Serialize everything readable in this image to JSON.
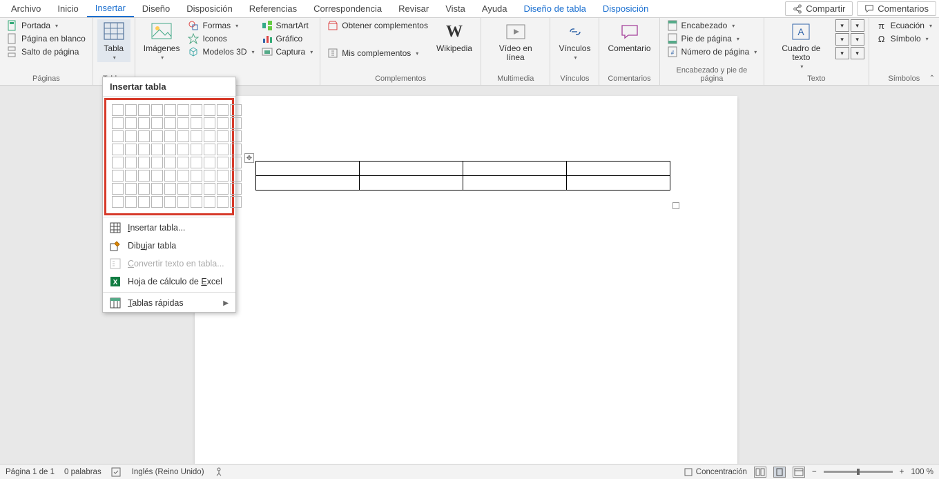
{
  "tabs": {
    "file": "Archivo",
    "home": "Inicio",
    "insert": "Insertar",
    "design": "Diseño",
    "layout": "Disposición",
    "references": "Referencias",
    "mail": "Correspondencia",
    "review": "Revisar",
    "view": "Vista",
    "help": "Ayuda",
    "table_design": "Diseño de tabla",
    "table_layout": "Disposición"
  },
  "top_buttons": {
    "share": "Compartir",
    "comments": "Comentarios"
  },
  "ribbon": {
    "pages": {
      "label": "Páginas",
      "cover": "Portada",
      "blank": "Página en blanco",
      "break": "Salto de página"
    },
    "tables": {
      "label": "Tablas",
      "button": "Tabla"
    },
    "illustrations": {
      "label": "nes",
      "images": "Imágenes",
      "shapes": "Formas",
      "icons": "Iconos",
      "models3d": "Modelos 3D",
      "smartart": "SmartArt",
      "chart": "Gráfico",
      "screenshot": "Captura"
    },
    "addins": {
      "label": "Complementos",
      "get": "Obtener complementos",
      "my": "Mis complementos",
      "wikipedia": "Wikipedia"
    },
    "media": {
      "label": "Multimedia",
      "video": "Vídeo en línea"
    },
    "links": {
      "label": "Vínculos",
      "button": "Vínculos"
    },
    "comments": {
      "label": "Comentarios",
      "button": "Comentario"
    },
    "header_footer": {
      "label": "Encabezado y pie de página",
      "header": "Encabezado",
      "footer": "Pie de página",
      "pagenum": "Número de página"
    },
    "text": {
      "label": "Texto",
      "textbox": "Cuadro de texto"
    },
    "symbols": {
      "label": "Símbolos",
      "equation": "Ecuación",
      "symbol": "Símbolo"
    }
  },
  "dropdown": {
    "title": "Insertar tabla",
    "insert_table": "Insertar tabla...",
    "draw_table": "Dibujar tabla",
    "convert": "Convertir texto en tabla...",
    "excel": "Hoja de cálculo de Excel",
    "quick": "Tablas rápidas"
  },
  "status": {
    "page": "Página 1 de 1",
    "words": "0 palabras",
    "lang": "Inglés (Reino Unido)",
    "focus": "Concentración",
    "zoom": "100 %"
  },
  "doc": {
    "table_rows": 2,
    "table_cols": 4
  }
}
